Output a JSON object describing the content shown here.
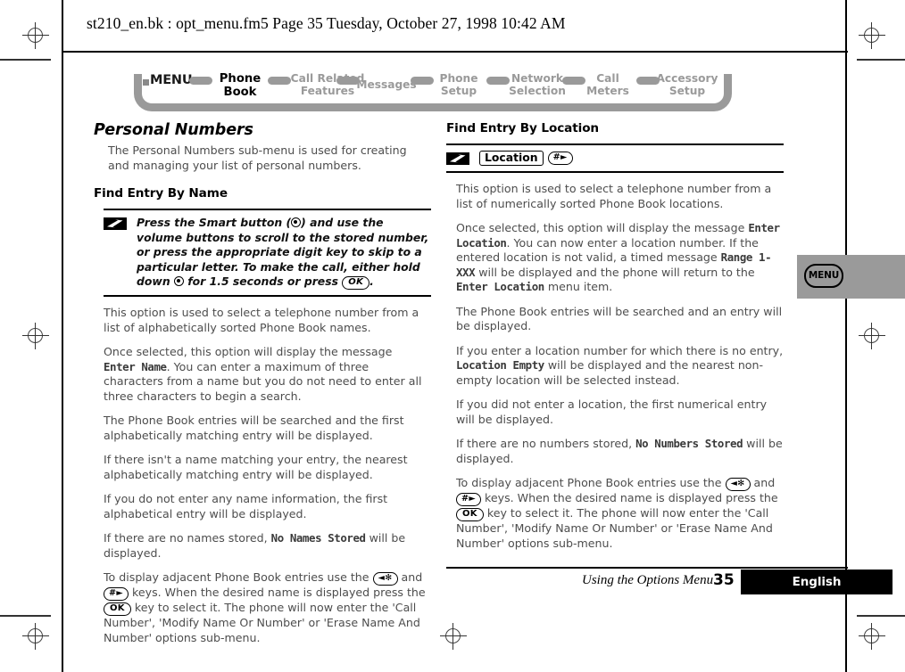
{
  "running_header": "st210_en.bk : opt_menu.fm5  Page 35  Tuesday, October 27, 1998  10:42 AM",
  "menu_bar": {
    "root_label": "MENU",
    "items": [
      {
        "line1": "Phone",
        "line2": "Book",
        "active": true
      },
      {
        "line1": "Call Related",
        "line2": "Features",
        "active": false
      },
      {
        "line1": "Messages",
        "line2": "",
        "active": false
      },
      {
        "line1": "Phone",
        "line2": "Setup",
        "active": false
      },
      {
        "line1": "Network",
        "line2": "Selection",
        "active": false
      },
      {
        "line1": "Call",
        "line2": "Meters",
        "active": false
      },
      {
        "line1": "Accessory",
        "line2": "Setup",
        "active": false
      }
    ],
    "active_color": "#000000",
    "inactive_color": "#9a9a9a"
  },
  "left_column": {
    "section_title": "Personal Numbers",
    "intro": "The Personal Numbers sub-menu is used for creating and managing your list of personal numbers.",
    "sub_title": "Find Entry By Name",
    "note": {
      "icon": "lightning-z-icon",
      "text_part1": "Press the Smart button (",
      "smart_button_glyph": "smart-button-icon",
      "text_part2": ") and use the volume buttons to scroll to the stored number, or press the appropriate digit key to skip to a particular letter. To make the call, either hold down ",
      "text_part3": " for 1.5 seconds or press ",
      "ok_key": "OK",
      "text_part4": "."
    },
    "paragraphs": [
      {
        "id": "p1",
        "pre": "This option is used to select a telephone number from a list of alphabetically sorted Phone Book names.",
        "lcd": "",
        "post": ""
      },
      {
        "id": "p2",
        "pre": "Once selected, this option will display the message ",
        "lcd": "Enter Name",
        "post": ". You can enter a maximum of three characters from a name but you do not need to enter all three characters to begin a search."
      },
      {
        "id": "p3",
        "pre": "The Phone Book entries will be searched and the first alphabetically matching entry will be displayed.",
        "lcd": "",
        "post": ""
      },
      {
        "id": "p4",
        "pre": "If there isn't a name matching your entry, the nearest alphabetically matching entry will be displayed.",
        "lcd": "",
        "post": ""
      },
      {
        "id": "p5",
        "pre": "If you do not enter any name information, the first alphabetical entry will be displayed.",
        "lcd": "",
        "post": ""
      },
      {
        "id": "p6",
        "pre": "If there are no names stored, ",
        "lcd": "No Names Stored",
        "post": " will be displayed."
      }
    ],
    "adjacent": {
      "pre": "To display adjacent Phone Book entries use the ",
      "key_star": "◄✻",
      "mid1": " and ",
      "key_hash": "#►",
      "mid2": " keys. When the desired name is displayed press the ",
      "key_ok": "OK",
      "post": " key to select it. The phone will now enter the 'Call Number', 'Modify Name Or Number' or 'Erase Name And Number' options sub-menu."
    }
  },
  "right_column": {
    "sub_title": "Find Entry By Location",
    "note": {
      "icon": "lightning-z-icon",
      "location_key": "Location",
      "hash_key": "#►"
    },
    "paragraphs": [
      {
        "id": "r1",
        "pre": "This option is used to select a telephone number from a list of numerically sorted Phone Book locations.",
        "lcd": "",
        "post": ""
      },
      {
        "id": "r2",
        "pre": "Once selected, this option will display the message ",
        "lcd": "Enter Location",
        "post": ". You can now enter a location number. If the entered location is not valid, a timed message ",
        "lcd2": "Range 1-XXX",
        "post2": " will be displayed and the phone will return to the ",
        "lcd3": "Enter Location",
        "post3": " menu item."
      },
      {
        "id": "r3",
        "pre": "The Phone Book entries will be searched and an entry will be displayed.",
        "lcd": "",
        "post": ""
      },
      {
        "id": "r4",
        "pre": "If you enter a location number for which there is no entry, ",
        "lcd": "Location Empty",
        "post": " will be displayed and the nearest non-empty location will be selected instead."
      },
      {
        "id": "r5",
        "pre": "If you did not enter a location, the first numerical entry will be displayed.",
        "lcd": "",
        "post": ""
      },
      {
        "id": "r6",
        "pre": "If there are no numbers stored, ",
        "lcd": "No Numbers Stored",
        "post": " will be displayed."
      }
    ],
    "adjacent": {
      "pre": "To display adjacent Phone Book entries use the ",
      "key_star": "◄✻",
      "mid1": " and ",
      "key_hash": "#►",
      "mid2": " keys. When the desired name is displayed press the ",
      "key_ok": "OK",
      "post": " key to select it. The phone will now enter the 'Call Number', 'Modify Name Or Number' or 'Erase Name And Number' options sub-menu."
    }
  },
  "side_tab": {
    "label": "MENU",
    "background": "#9a9a9a"
  },
  "footer": {
    "chapter": "Using the Options Menu",
    "page_number": "35",
    "language": "English"
  }
}
